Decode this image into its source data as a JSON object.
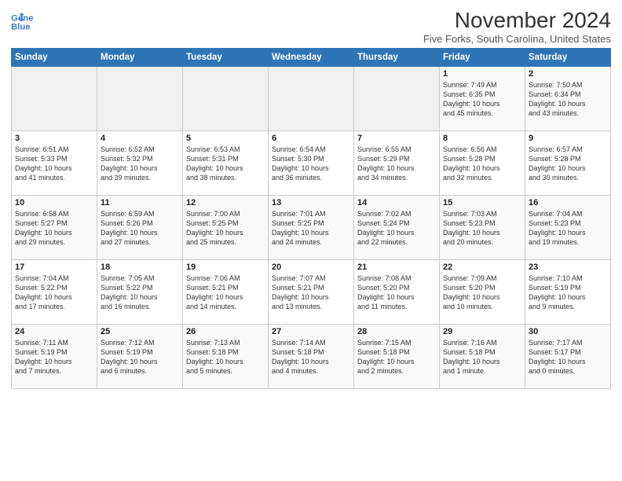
{
  "header": {
    "logo_line1": "General",
    "logo_line2": "Blue",
    "title": "November 2024",
    "location": "Five Forks, South Carolina, United States"
  },
  "weekdays": [
    "Sunday",
    "Monday",
    "Tuesday",
    "Wednesday",
    "Thursday",
    "Friday",
    "Saturday"
  ],
  "weeks": [
    [
      {
        "day": "",
        "info": ""
      },
      {
        "day": "",
        "info": ""
      },
      {
        "day": "",
        "info": ""
      },
      {
        "day": "",
        "info": ""
      },
      {
        "day": "",
        "info": ""
      },
      {
        "day": "1",
        "info": "Sunrise: 7:49 AM\nSunset: 6:35 PM\nDaylight: 10 hours\nand 45 minutes."
      },
      {
        "day": "2",
        "info": "Sunrise: 7:50 AM\nSunset: 6:34 PM\nDaylight: 10 hours\nand 43 minutes."
      }
    ],
    [
      {
        "day": "3",
        "info": "Sunrise: 6:51 AM\nSunset: 5:33 PM\nDaylight: 10 hours\nand 41 minutes."
      },
      {
        "day": "4",
        "info": "Sunrise: 6:52 AM\nSunset: 5:32 PM\nDaylight: 10 hours\nand 39 minutes."
      },
      {
        "day": "5",
        "info": "Sunrise: 6:53 AM\nSunset: 5:31 PM\nDaylight: 10 hours\nand 38 minutes."
      },
      {
        "day": "6",
        "info": "Sunrise: 6:54 AM\nSunset: 5:30 PM\nDaylight: 10 hours\nand 36 minutes."
      },
      {
        "day": "7",
        "info": "Sunrise: 6:55 AM\nSunset: 5:29 PM\nDaylight: 10 hours\nand 34 minutes."
      },
      {
        "day": "8",
        "info": "Sunrise: 6:56 AM\nSunset: 5:28 PM\nDaylight: 10 hours\nand 32 minutes."
      },
      {
        "day": "9",
        "info": "Sunrise: 6:57 AM\nSunset: 5:28 PM\nDaylight: 10 hours\nand 30 minutes."
      }
    ],
    [
      {
        "day": "10",
        "info": "Sunrise: 6:58 AM\nSunset: 5:27 PM\nDaylight: 10 hours\nand 29 minutes."
      },
      {
        "day": "11",
        "info": "Sunrise: 6:59 AM\nSunset: 5:26 PM\nDaylight: 10 hours\nand 27 minutes."
      },
      {
        "day": "12",
        "info": "Sunrise: 7:00 AM\nSunset: 5:25 PM\nDaylight: 10 hours\nand 25 minutes."
      },
      {
        "day": "13",
        "info": "Sunrise: 7:01 AM\nSunset: 5:25 PM\nDaylight: 10 hours\nand 24 minutes."
      },
      {
        "day": "14",
        "info": "Sunrise: 7:02 AM\nSunset: 5:24 PM\nDaylight: 10 hours\nand 22 minutes."
      },
      {
        "day": "15",
        "info": "Sunrise: 7:03 AM\nSunset: 5:23 PM\nDaylight: 10 hours\nand 20 minutes."
      },
      {
        "day": "16",
        "info": "Sunrise: 7:04 AM\nSunset: 5:23 PM\nDaylight: 10 hours\nand 19 minutes."
      }
    ],
    [
      {
        "day": "17",
        "info": "Sunrise: 7:04 AM\nSunset: 5:22 PM\nDaylight: 10 hours\nand 17 minutes."
      },
      {
        "day": "18",
        "info": "Sunrise: 7:05 AM\nSunset: 5:22 PM\nDaylight: 10 hours\nand 16 minutes."
      },
      {
        "day": "19",
        "info": "Sunrise: 7:06 AM\nSunset: 5:21 PM\nDaylight: 10 hours\nand 14 minutes."
      },
      {
        "day": "20",
        "info": "Sunrise: 7:07 AM\nSunset: 5:21 PM\nDaylight: 10 hours\nand 13 minutes."
      },
      {
        "day": "21",
        "info": "Sunrise: 7:08 AM\nSunset: 5:20 PM\nDaylight: 10 hours\nand 11 minutes."
      },
      {
        "day": "22",
        "info": "Sunrise: 7:09 AM\nSunset: 5:20 PM\nDaylight: 10 hours\nand 10 minutes."
      },
      {
        "day": "23",
        "info": "Sunrise: 7:10 AM\nSunset: 5:19 PM\nDaylight: 10 hours\nand 9 minutes."
      }
    ],
    [
      {
        "day": "24",
        "info": "Sunrise: 7:11 AM\nSunset: 5:19 PM\nDaylight: 10 hours\nand 7 minutes."
      },
      {
        "day": "25",
        "info": "Sunrise: 7:12 AM\nSunset: 5:19 PM\nDaylight: 10 hours\nand 6 minutes."
      },
      {
        "day": "26",
        "info": "Sunrise: 7:13 AM\nSunset: 5:18 PM\nDaylight: 10 hours\nand 5 minutes."
      },
      {
        "day": "27",
        "info": "Sunrise: 7:14 AM\nSunset: 5:18 PM\nDaylight: 10 hours\nand 4 minutes."
      },
      {
        "day": "28",
        "info": "Sunrise: 7:15 AM\nSunset: 5:18 PM\nDaylight: 10 hours\nand 2 minutes."
      },
      {
        "day": "29",
        "info": "Sunrise: 7:16 AM\nSunset: 5:18 PM\nDaylight: 10 hours\nand 1 minute."
      },
      {
        "day": "30",
        "info": "Sunrise: 7:17 AM\nSunset: 5:17 PM\nDaylight: 10 hours\nand 0 minutes."
      }
    ]
  ]
}
